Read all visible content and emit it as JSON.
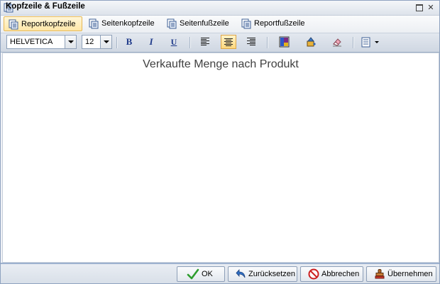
{
  "window": {
    "title": "Kopfzeile & Fußzeile"
  },
  "tabs": [
    {
      "label": "Reportkopfzeile",
      "active": true
    },
    {
      "label": "Seitenkopfzeile",
      "active": false
    },
    {
      "label": "Seitenfußzeile",
      "active": false
    },
    {
      "label": "Reportfußzeile",
      "active": false
    }
  ],
  "toolbar": {
    "font_value": "HELVETICA",
    "size_value": "12",
    "bold_label": "B",
    "italic_label": "I",
    "underline_label": "U",
    "align_selected": "center"
  },
  "editor": {
    "text": "Verkaufte Menge nach Produkt"
  },
  "buttons": {
    "ok": "OK",
    "reset": "Zurücksetzen",
    "cancel": "Abbrechen",
    "apply": "Übernehmen"
  },
  "colors": {
    "active_tab": "#ffe7a8",
    "ok_check": "#2e9d2e",
    "cancel_icon": "#cc2020"
  }
}
